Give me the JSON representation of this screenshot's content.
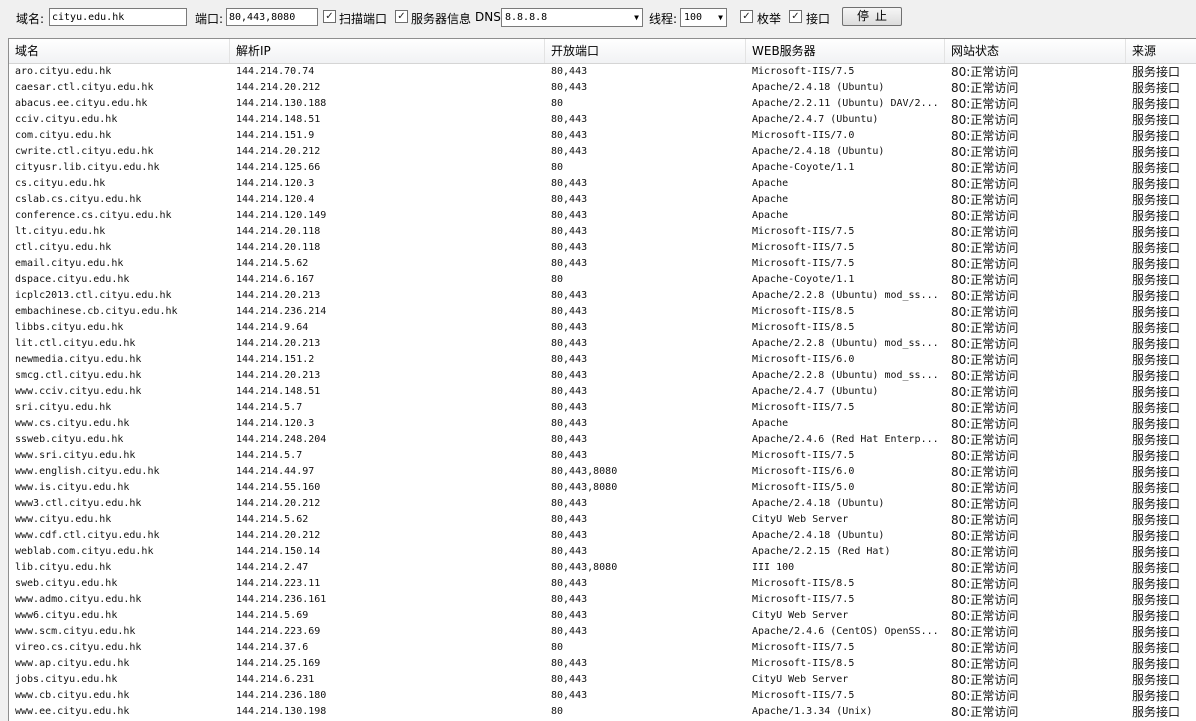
{
  "toolbar": {
    "domain_label": "域名:",
    "domain_value": "cityu.edu.hk",
    "port_label": "端口:",
    "port_value": "80,443,8080",
    "scan_ports_checked": "✓",
    "scan_ports_label": "扫描端口",
    "server_info_checked": "✓",
    "server_info_label": "服务器信息",
    "dns_label": "DNS:",
    "dns_value": "8.8.8.8",
    "threads_label": "线程:",
    "threads_value": "100",
    "enum_checked": "✓",
    "enum_label": "枚举",
    "api_checked": "✓",
    "api_label": "接口",
    "stop_button": "停止"
  },
  "icons": {
    "dropdown": "chevron-down-icon",
    "checkbox": "checkmark-icon"
  },
  "table": {
    "columns": [
      "域名",
      "解析IP",
      "开放端口",
      "WEB服务器",
      "网站状态",
      "来源"
    ],
    "rows": [
      [
        "aro.cityu.edu.hk",
        "144.214.70.74",
        "80,443",
        "Microsoft-IIS/7.5",
        "80:正常访问",
        "服务接口"
      ],
      [
        "caesar.ctl.cityu.edu.hk",
        "144.214.20.212",
        "80,443",
        "Apache/2.4.18 (Ubuntu)",
        "80:正常访问",
        "服务接口"
      ],
      [
        "abacus.ee.cityu.edu.hk",
        "144.214.130.188",
        "80",
        "Apache/2.2.11 (Ubuntu) DAV/2...",
        "80:正常访问",
        "服务接口"
      ],
      [
        "cciv.cityu.edu.hk",
        "144.214.148.51",
        "80,443",
        "Apache/2.4.7 (Ubuntu)",
        "80:正常访问",
        "服务接口"
      ],
      [
        "com.cityu.edu.hk",
        "144.214.151.9",
        "80,443",
        "Microsoft-IIS/7.0",
        "80:正常访问",
        "服务接口"
      ],
      [
        "cwrite.ctl.cityu.edu.hk",
        "144.214.20.212",
        "80,443",
        "Apache/2.4.18 (Ubuntu)",
        "80:正常访问",
        "服务接口"
      ],
      [
        "cityusr.lib.cityu.edu.hk",
        "144.214.125.66",
        "80",
        "Apache-Coyote/1.1",
        "80:正常访问",
        "服务接口"
      ],
      [
        "cs.cityu.edu.hk",
        "144.214.120.3",
        "80,443",
        "Apache",
        "80:正常访问",
        "服务接口"
      ],
      [
        "cslab.cs.cityu.edu.hk",
        "144.214.120.4",
        "80,443",
        "Apache",
        "80:正常访问",
        "服务接口"
      ],
      [
        "conference.cs.cityu.edu.hk",
        "144.214.120.149",
        "80,443",
        "Apache",
        "80:正常访问",
        "服务接口"
      ],
      [
        "lt.cityu.edu.hk",
        "144.214.20.118",
        "80,443",
        "Microsoft-IIS/7.5",
        "80:正常访问",
        "服务接口"
      ],
      [
        "ctl.cityu.edu.hk",
        "144.214.20.118",
        "80,443",
        "Microsoft-IIS/7.5",
        "80:正常访问",
        "服务接口"
      ],
      [
        "email.cityu.edu.hk",
        "144.214.5.62",
        "80,443",
        "Microsoft-IIS/7.5",
        "80:正常访问",
        "服务接口"
      ],
      [
        "dspace.cityu.edu.hk",
        "144.214.6.167",
        "80",
        "Apache-Coyote/1.1",
        "80:正常访问",
        "服务接口"
      ],
      [
        "icplc2013.ctl.cityu.edu.hk",
        "144.214.20.213",
        "80,443",
        "Apache/2.2.8 (Ubuntu) mod_ss...",
        "80:正常访问",
        "服务接口"
      ],
      [
        "embachinese.cb.cityu.edu.hk",
        "144.214.236.214",
        "80,443",
        "Microsoft-IIS/8.5",
        "80:正常访问",
        "服务接口"
      ],
      [
        "libbs.cityu.edu.hk",
        "144.214.9.64",
        "80,443",
        "Microsoft-IIS/8.5",
        "80:正常访问",
        "服务接口"
      ],
      [
        "lit.ctl.cityu.edu.hk",
        "144.214.20.213",
        "80,443",
        "Apache/2.2.8 (Ubuntu) mod_ss...",
        "80:正常访问",
        "服务接口"
      ],
      [
        "newmedia.cityu.edu.hk",
        "144.214.151.2",
        "80,443",
        "Microsoft-IIS/6.0",
        "80:正常访问",
        "服务接口"
      ],
      [
        "smcg.ctl.cityu.edu.hk",
        "144.214.20.213",
        "80,443",
        "Apache/2.2.8 (Ubuntu) mod_ss...",
        "80:正常访问",
        "服务接口"
      ],
      [
        "www.cciv.cityu.edu.hk",
        "144.214.148.51",
        "80,443",
        "Apache/2.4.7 (Ubuntu)",
        "80:正常访问",
        "服务接口"
      ],
      [
        "sri.cityu.edu.hk",
        "144.214.5.7",
        "80,443",
        "Microsoft-IIS/7.5",
        "80:正常访问",
        "服务接口"
      ],
      [
        "www.cs.cityu.edu.hk",
        "144.214.120.3",
        "80,443",
        "Apache",
        "80:正常访问",
        "服务接口"
      ],
      [
        "ssweb.cityu.edu.hk",
        "144.214.248.204",
        "80,443",
        "Apache/2.4.6 (Red Hat Enterp...",
        "80:正常访问",
        "服务接口"
      ],
      [
        "www.sri.cityu.edu.hk",
        "144.214.5.7",
        "80,443",
        "Microsoft-IIS/7.5",
        "80:正常访问",
        "服务接口"
      ],
      [
        "www.english.cityu.edu.hk",
        "144.214.44.97",
        "80,443,8080",
        "Microsoft-IIS/6.0",
        "80:正常访问",
        "服务接口"
      ],
      [
        "www.is.cityu.edu.hk",
        "144.214.55.160",
        "80,443,8080",
        "Microsoft-IIS/5.0",
        "80:正常访问",
        "服务接口"
      ],
      [
        "www3.ctl.cityu.edu.hk",
        "144.214.20.212",
        "80,443",
        "Apache/2.4.18 (Ubuntu)",
        "80:正常访问",
        "服务接口"
      ],
      [
        "www.cityu.edu.hk",
        "144.214.5.62",
        "80,443",
        "CityU Web Server",
        "80:正常访问",
        "服务接口"
      ],
      [
        "www.cdf.ctl.cityu.edu.hk",
        "144.214.20.212",
        "80,443",
        "Apache/2.4.18 (Ubuntu)",
        "80:正常访问",
        "服务接口"
      ],
      [
        "weblab.com.cityu.edu.hk",
        "144.214.150.14",
        "80,443",
        "Apache/2.2.15 (Red Hat)",
        "80:正常访问",
        "服务接口"
      ],
      [
        "lib.cityu.edu.hk",
        "144.214.2.47",
        "80,443,8080",
        "III 100",
        "80:正常访问",
        "服务接口"
      ],
      [
        "sweb.cityu.edu.hk",
        "144.214.223.11",
        "80,443",
        "Microsoft-IIS/8.5",
        "80:正常访问",
        "服务接口"
      ],
      [
        "www.admo.cityu.edu.hk",
        "144.214.236.161",
        "80,443",
        "Microsoft-IIS/7.5",
        "80:正常访问",
        "服务接口"
      ],
      [
        "www6.cityu.edu.hk",
        "144.214.5.69",
        "80,443",
        "CityU Web Server",
        "80:正常访问",
        "服务接口"
      ],
      [
        "www.scm.cityu.edu.hk",
        "144.214.223.69",
        "80,443",
        "Apache/2.4.6 (CentOS) OpenSS...",
        "80:正常访问",
        "服务接口"
      ],
      [
        "vireo.cs.cityu.edu.hk",
        "144.214.37.6",
        "80",
        "Microsoft-IIS/7.5",
        "80:正常访问",
        "服务接口"
      ],
      [
        "www.ap.cityu.edu.hk",
        "144.214.25.169",
        "80,443",
        "Microsoft-IIS/8.5",
        "80:正常访问",
        "服务接口"
      ],
      [
        "jobs.cityu.edu.hk",
        "144.214.6.231",
        "80,443",
        "CityU Web Server",
        "80:正常访问",
        "服务接口"
      ],
      [
        "www.cb.cityu.edu.hk",
        "144.214.236.180",
        "80,443",
        "Microsoft-IIS/7.5",
        "80:正常访问",
        "服务接口"
      ],
      [
        "www.ee.cityu.edu.hk",
        "144.214.130.198",
        "80",
        "Apache/1.3.34 (Unix)",
        "80:正常访问",
        "服务接口"
      ]
    ]
  }
}
